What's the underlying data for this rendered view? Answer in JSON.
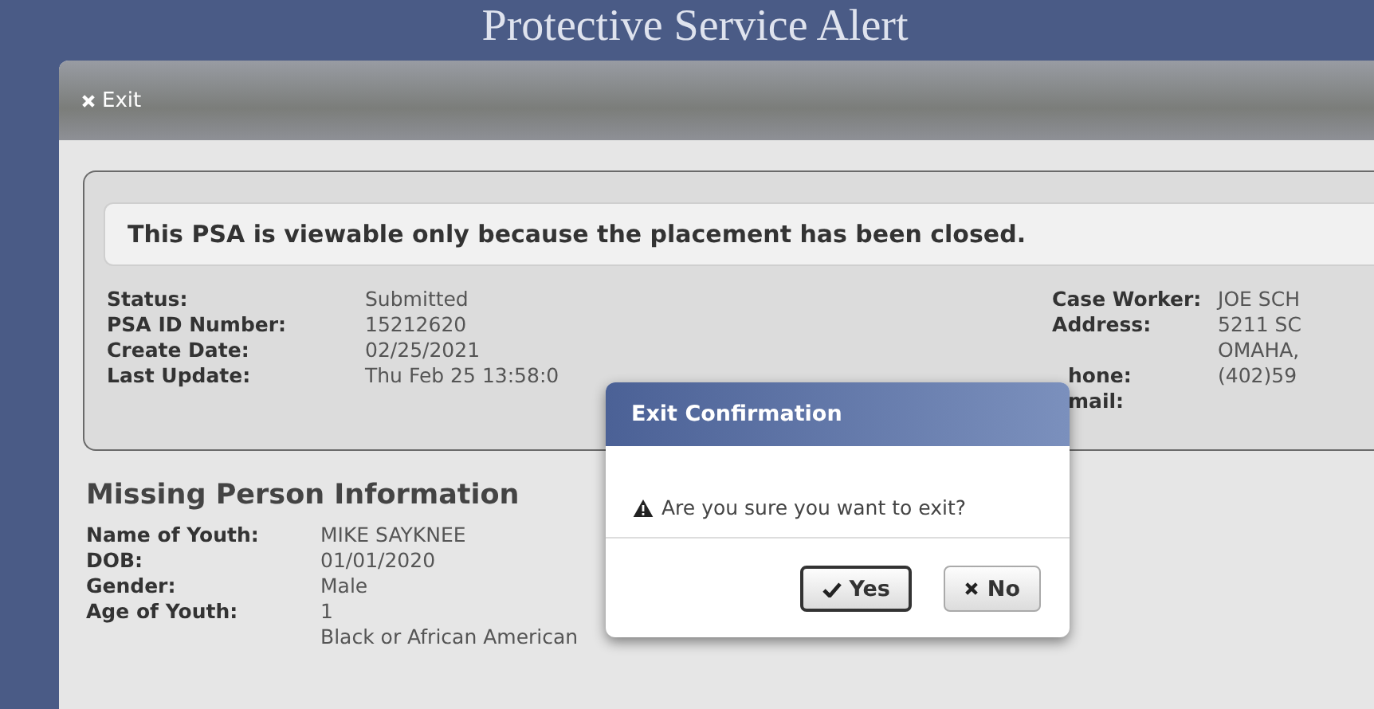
{
  "page_title": "Protective Service Alert",
  "exit_button": {
    "label": "Exit"
  },
  "notice": "This PSA is viewable only because the placement has been closed.",
  "case_info": {
    "left": [
      {
        "label": "Status:",
        "value": "Submitted"
      },
      {
        "label": "PSA ID Number:",
        "value": "15212620"
      },
      {
        "label": "Create Date:",
        "value": "02/25/2021"
      },
      {
        "label": "Last Update:",
        "value": "Thu Feb 25 13:58:0"
      }
    ],
    "right": [
      {
        "label": "Case Worker:",
        "values": [
          "JOE SCH"
        ]
      },
      {
        "label": "Address:",
        "values": [
          "5211 SC",
          "OMAHA,"
        ]
      },
      {
        "label": "hone:",
        "values": [
          "(402)59"
        ]
      },
      {
        "label": "mail:"
      }
    ]
  },
  "missing_person": {
    "heading": "Missing Person Information",
    "fields": [
      {
        "label": "Name of Youth:",
        "value": "MIKE SAYKNEE"
      },
      {
        "label": "DOB:",
        "value": "01/01/2020"
      },
      {
        "label": "Gender:",
        "value": "Male"
      },
      {
        "label": "Age of Youth:",
        "value": "1"
      },
      {
        "value": "Black or African American"
      }
    ]
  },
  "dialog": {
    "title": "Exit Confirmation",
    "message": "Are you sure you want to exit?",
    "buttons": [
      {
        "label": "Yes",
        "kind": "confirm",
        "focused": true
      },
      {
        "label": "No",
        "kind": "cancel",
        "focused": false
      }
    ]
  }
}
